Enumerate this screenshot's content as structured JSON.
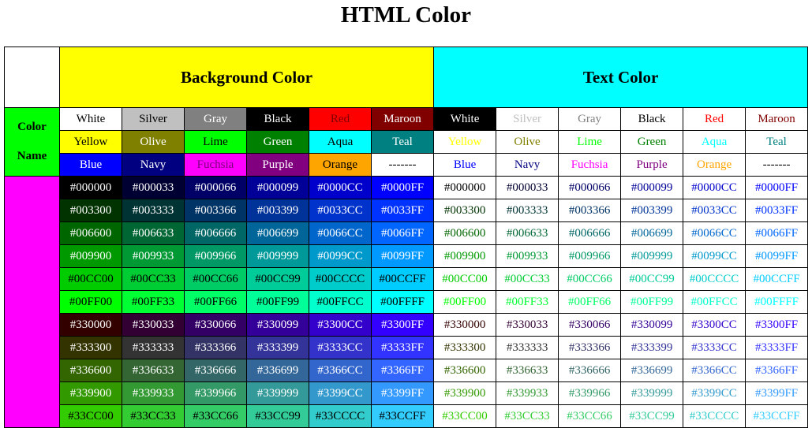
{
  "page": {
    "title": "HTML Color"
  },
  "table": {
    "corner": "",
    "bg_header": {
      "label": "Background Color",
      "color": "#FFFF00"
    },
    "text_header": {
      "label": "Text Color",
      "color": "#00FFFF"
    },
    "name_label": {
      "line1": "Color",
      "line2": "Name",
      "color": "#00FF00"
    },
    "side_color": "#FF00FF",
    "named_rows": [
      [
        {
          "name": "White",
          "bg": "#FFFFFF",
          "fg": "#000000",
          "tc": "#FFFFFF",
          "tbg": "#000000"
        },
        {
          "name": "Silver",
          "bg": "#C0C0C0",
          "fg": "#000000",
          "tc": "#C0C0C0"
        },
        {
          "name": "Gray",
          "bg": "#808080",
          "fg": "#FFFFFF",
          "tc": "#808080"
        },
        {
          "name": "Black",
          "bg": "#000000",
          "fg": "#FFFFFF",
          "tc": "#000000"
        },
        {
          "name": "Red",
          "bg": "#FF0000",
          "fg": "#800000",
          "tc": "#FF0000"
        },
        {
          "name": "Maroon",
          "bg": "#800000",
          "fg": "#FFFFFF",
          "tc": "#800000"
        }
      ],
      [
        {
          "name": "Yellow",
          "bg": "#FFFF00",
          "fg": "#000000",
          "tc": "#FFFF00"
        },
        {
          "name": "Olive",
          "bg": "#808000",
          "fg": "#FFFFFF",
          "tc": "#808000"
        },
        {
          "name": "Lime",
          "bg": "#00FF00",
          "fg": "#000000",
          "tc": "#00FF00"
        },
        {
          "name": "Green",
          "bg": "#008000",
          "fg": "#FFFFFF",
          "tc": "#008000"
        },
        {
          "name": "Aqua",
          "bg": "#00FFFF",
          "fg": "#000000",
          "tc": "#00FFFF"
        },
        {
          "name": "Teal",
          "bg": "#008080",
          "fg": "#FFFFFF",
          "tc": "#008080"
        }
      ],
      [
        {
          "name": "Blue",
          "bg": "#0000FF",
          "fg": "#FFFFFF",
          "tc": "#0000FF"
        },
        {
          "name": "Navy",
          "bg": "#000080",
          "fg": "#FFFFFF",
          "tc": "#000080"
        },
        {
          "name": "Fuchsia",
          "bg": "#FF00FF",
          "fg": "#800080",
          "tc": "#FF00FF"
        },
        {
          "name": "Purple",
          "bg": "#800080",
          "fg": "#FFFFFF",
          "tc": "#800080"
        },
        {
          "name": "Orange",
          "bg": "#FFA500",
          "fg": "#000000",
          "tc": "#FFA500"
        },
        {
          "name": "-------",
          "bg": "#FFFFFF",
          "fg": "#000000",
          "tc": "#000000"
        }
      ]
    ],
    "hex_rows": [
      [
        "#000000",
        "#000033",
        "#000066",
        "#000099",
        "#0000CC",
        "#0000FF"
      ],
      [
        "#003300",
        "#003333",
        "#003366",
        "#003399",
        "#0033CC",
        "#0033FF"
      ],
      [
        "#006600",
        "#006633",
        "#006666",
        "#006699",
        "#0066CC",
        "#0066FF"
      ],
      [
        "#009900",
        "#009933",
        "#009966",
        "#009999",
        "#0099CC",
        "#0099FF"
      ],
      [
        "#00CC00",
        "#00CC33",
        "#00CC66",
        "#00CC99",
        "#00CCCC",
        "#00CCFF"
      ],
      [
        "#00FF00",
        "#00FF33",
        "#00FF66",
        "#00FF99",
        "#00FFCC",
        "#00FFFF"
      ],
      [
        "#330000",
        "#330033",
        "#330066",
        "#330099",
        "#3300CC",
        "#3300FF"
      ],
      [
        "#333300",
        "#333333",
        "#333366",
        "#333399",
        "#3333CC",
        "#3333FF"
      ],
      [
        "#336600",
        "#336633",
        "#336666",
        "#336699",
        "#3366CC",
        "#3366FF"
      ],
      [
        "#339900",
        "#339933",
        "#339966",
        "#339999",
        "#3399CC",
        "#3399FF"
      ],
      [
        "#33CC00",
        "#33CC33",
        "#33CC66",
        "#33CC99",
        "#33CCCC",
        "#33CCFF"
      ]
    ],
    "hex_dark_text": "#FFFFFF",
    "hex_light_text": "#000000",
    "light_rows": [
      4,
      5,
      10
    ]
  }
}
